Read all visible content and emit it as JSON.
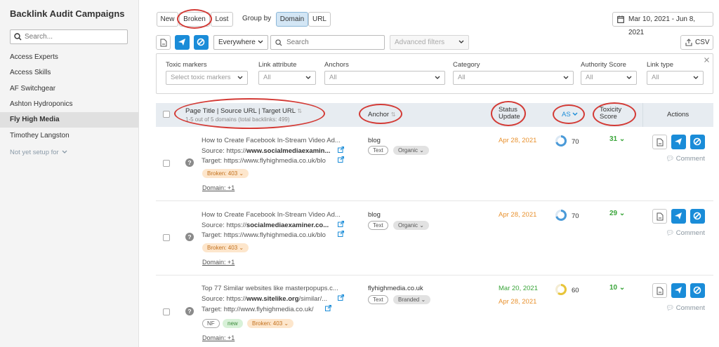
{
  "sidebar": {
    "title": "Backlink Audit Campaigns",
    "search_placeholder": "Search...",
    "items": [
      {
        "label": "Access Experts",
        "active": false
      },
      {
        "label": "Access Skills",
        "active": false
      },
      {
        "label": "AF Switchgear",
        "active": false
      },
      {
        "label": "Ashton Hydroponics",
        "active": false
      },
      {
        "label": "Fly High Media",
        "active": true
      },
      {
        "label": "Timothey Langston",
        "active": false
      }
    ],
    "setup_label": "Not yet setup for"
  },
  "toolbar": {
    "tabs": [
      "New",
      "Broken",
      "Lost"
    ],
    "selected_tab": "Broken",
    "group_by_label": "Group by",
    "group_options": [
      "Domain",
      "URL"
    ],
    "selected_group": "Domain",
    "date_range": "Mar 10, 2021 - Jun 8, 2021",
    "scope_value": "Everywhere",
    "search_placeholder": "Search",
    "advanced_filters_label": "Advanced filters",
    "csv_label": "CSV"
  },
  "filters": [
    {
      "label": "Toxic markers",
      "value": "Select toxic markers"
    },
    {
      "label": "Link attribute",
      "value": "All"
    },
    {
      "label": "Anchors",
      "value": "All"
    },
    {
      "label": "Category",
      "value": "All"
    },
    {
      "label": "Authority Score",
      "value": "All"
    },
    {
      "label": "Link type",
      "value": "All"
    }
  ],
  "table": {
    "columns": {
      "title": "Page Title | Source URL | Target URL",
      "title_sub": "1-5 out of 5 domains (total backlinks: 499)",
      "anchor": "Anchor",
      "status_line1": "Status",
      "status_line2": "Update",
      "as": "AS",
      "toxicity_line1": "Toxicity",
      "toxicity_line2": "Score",
      "actions": "Actions"
    },
    "source_prefix": "Source: ",
    "target_prefix": "Target: ",
    "comment_label": "Comment",
    "rows": [
      {
        "title": "How to Create Facebook In-Stream Video Ad...",
        "source_scheme": "https://",
        "source_domain": "www.socialmediaexamin...",
        "target": "https://www.flyhighmedia.co.uk/blo",
        "tags": [
          {
            "label": "Broken: 403",
            "style": "orange"
          }
        ],
        "domain_link": "Domain: +1",
        "anchor": "blog",
        "anchor_tags": [
          {
            "label": "Text",
            "style": "gray"
          },
          {
            "label": "Organic",
            "style": "graybg"
          }
        ],
        "dates": [
          {
            "text": "Apr 28, 2021",
            "color": "#e8912d"
          }
        ],
        "as": 70,
        "as_color": "#4a9ad8",
        "toxicity": "31"
      },
      {
        "title": "How to Create Facebook In-Stream Video Ad...",
        "source_scheme": "https://",
        "source_domain": "socialmediaexaminer.co...",
        "target": "https://www.flyhighmedia.co.uk/blo",
        "tags": [
          {
            "label": "Broken: 403",
            "style": "orange"
          }
        ],
        "domain_link": "Domain: +1",
        "anchor": "blog",
        "anchor_tags": [
          {
            "label": "Text",
            "style": "gray"
          },
          {
            "label": "Organic",
            "style": "graybg"
          }
        ],
        "dates": [
          {
            "text": "Apr 28, 2021",
            "color": "#e8912d"
          }
        ],
        "as": 70,
        "as_color": "#4a9ad8",
        "toxicity": "29"
      },
      {
        "title": "Top 77 Similar websites like masterpopups.c...",
        "source_scheme": "https://",
        "source_domain": "www.sitelike.org",
        "source_rest": "/similar/...",
        "target": "http://www.flyhighmedia.co.uk/",
        "tags": [
          {
            "label": "NF",
            "style": "gray"
          },
          {
            "label": "new",
            "style": "green"
          },
          {
            "label": "Broken: 403",
            "style": "orange"
          }
        ],
        "domain_link": "Domain: +1",
        "anchor": "flyhighmedia.co.uk",
        "anchor_tags": [
          {
            "label": "Text",
            "style": "gray"
          },
          {
            "label": "Branded",
            "style": "graybg"
          }
        ],
        "dates": [
          {
            "text": "Mar 20, 2021",
            "color": "#3aa53a"
          },
          {
            "text": "Apr 28, 2021",
            "color": "#e8912d"
          }
        ],
        "as": 60,
        "as_color": "#e8c53a",
        "toxicity": "10"
      }
    ]
  },
  "colors": {
    "accent_blue": "#1a8cd8",
    "annotation_red": "#d33a35"
  }
}
